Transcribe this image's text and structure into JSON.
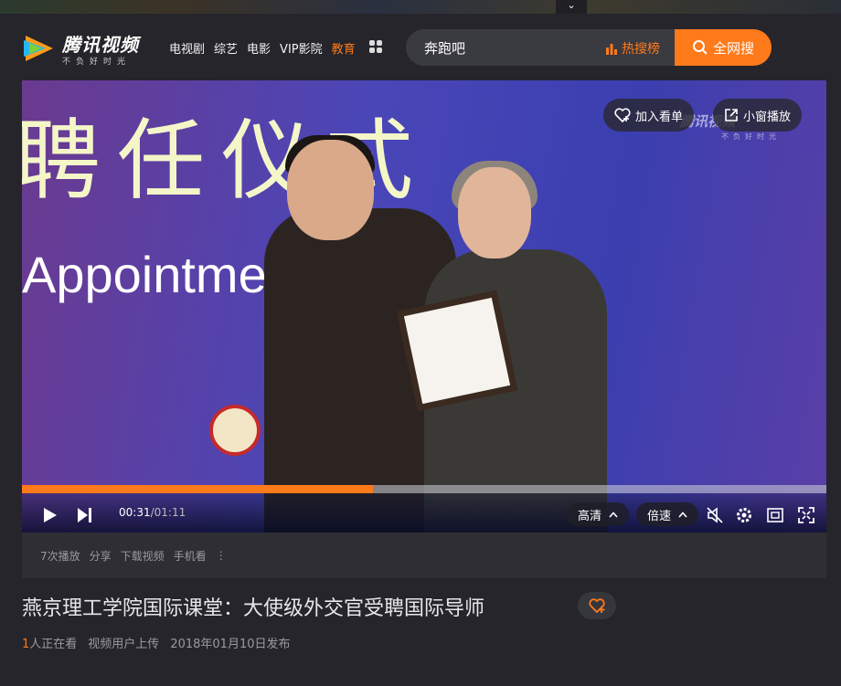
{
  "header": {
    "logo_title": "腾讯视频",
    "logo_sub": "不负好时光",
    "nav": [
      {
        "label": "电视剧",
        "active": false
      },
      {
        "label": "综艺",
        "active": false
      },
      {
        "label": "电影",
        "active": false
      },
      {
        "label": "VIP影院",
        "active": false
      },
      {
        "label": "教育",
        "active": true
      }
    ],
    "search": {
      "value": "奔跑吧",
      "hot_label": "热搜榜",
      "button_label": "全网搜"
    }
  },
  "player": {
    "stage_text_cn": "聘任仪式",
    "stage_text_en": "Appointment Ceremony",
    "add_watchlist_label": "加入看单",
    "miniplayer_label": "小窗播放",
    "watermark_title": "腾讯视频",
    "watermark_sub": "不负好时光",
    "current_time": "00:31",
    "duration": "/01:11",
    "progress_fraction": 0.436,
    "quality_label": "高清",
    "speed_label": "倍速"
  },
  "infobar": {
    "plays": "7次播放",
    "share": "分享",
    "download": "下载视频",
    "mobile": "手机看",
    "more": "⋮"
  },
  "video": {
    "title": "燕京理工学院国际课堂：大使级外交官受聘国际导师",
    "watching_count": "1",
    "watching_label": "人正在看",
    "uploader": "视频用户上传",
    "published": "2018年01月10日发布"
  },
  "colors": {
    "accent": "#ff7a1a",
    "background": "#25252b"
  }
}
